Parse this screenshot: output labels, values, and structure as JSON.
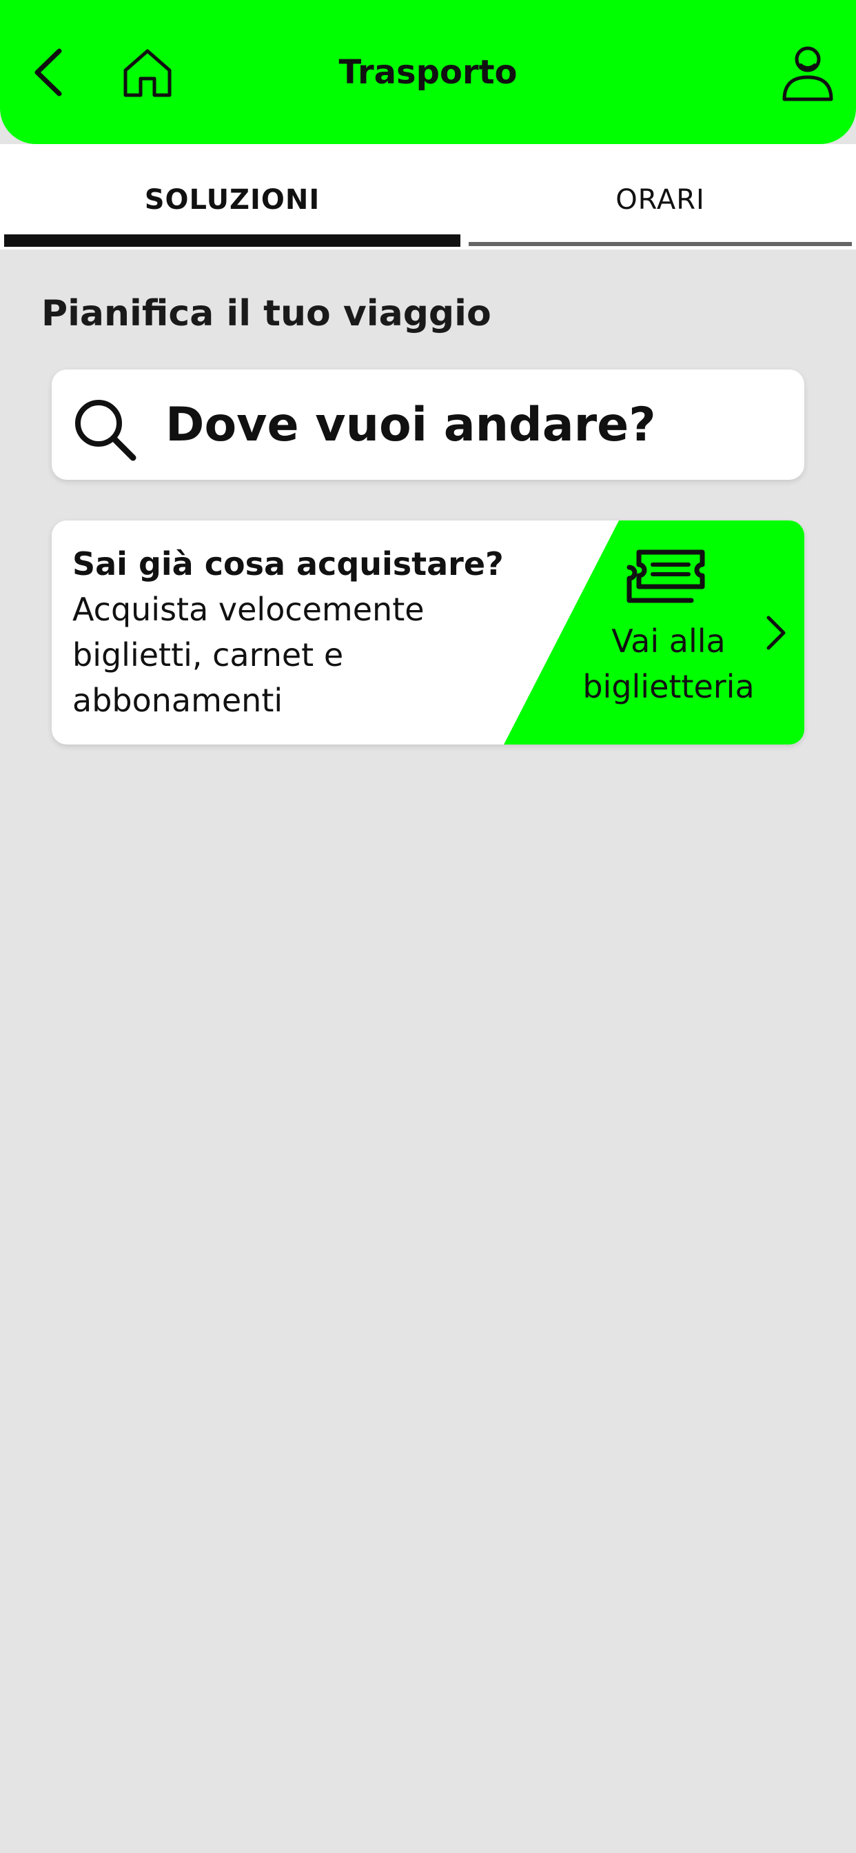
{
  "header": {
    "title": "Trasporto",
    "back_icon": "chevron-left-icon",
    "home_icon": "home-icon",
    "profile_icon": "user-icon",
    "background_color": "#00ff00"
  },
  "tabs": [
    {
      "label": "SOLUZIONI",
      "active": true
    },
    {
      "label": "ORARI",
      "active": false
    }
  ],
  "main": {
    "subtitle": "Pianifica il tuo viaggio",
    "search": {
      "placeholder": "Dove vuoi andare?",
      "icon": "search-icon"
    },
    "ticket_card": {
      "title": "Sai già cosa acquistare?",
      "description": "Acquista velocemente biglietti, carnet e abbonamenti",
      "cta_label": "Vai alla biglietteria",
      "cta_icon": "ticket-icon",
      "arrow_icon": "chevron-right-icon",
      "accent_color": "#00ff00"
    }
  }
}
